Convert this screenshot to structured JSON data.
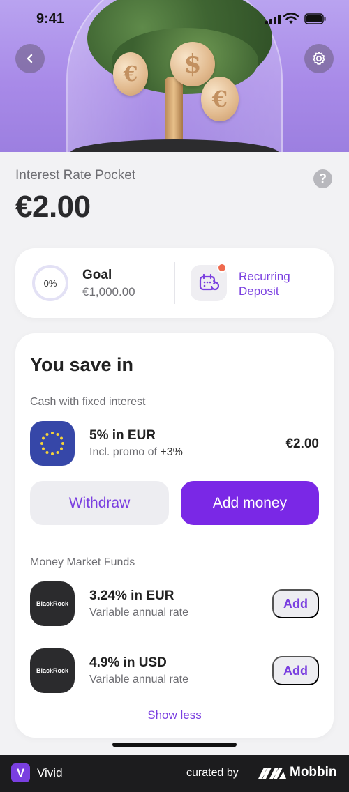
{
  "status_bar": {
    "time": "9:41"
  },
  "header": {
    "title": "Interest Rate Pocket",
    "balance": "€2.00",
    "help": "?"
  },
  "goal": {
    "progress_label": "0%",
    "progress": 0,
    "label": "Goal",
    "amount": "€1,000.00",
    "recurring_label": "Recurring Deposit"
  },
  "save": {
    "title": "You save in",
    "cash_section": "Cash with fixed interest",
    "eur_item": {
      "title": "5% in EUR",
      "subtitle_prefix": "Incl. promo of ",
      "subtitle_promo": "+3%",
      "value": "€2.00"
    },
    "withdraw_label": "Withdraw",
    "add_money_label": "Add money",
    "mmf_section": "Money Market Funds",
    "funds": [
      {
        "logo": "BlackRock",
        "title": "3.24% in EUR",
        "subtitle": "Variable annual rate",
        "action": "Add"
      },
      {
        "logo": "BlackRock",
        "title": "4.9% in USD",
        "subtitle": "Variable annual rate",
        "action": "Add"
      }
    ],
    "show_less": "Show less"
  },
  "footer": {
    "app_logo": "V",
    "app_name": "Vivid",
    "curated_by": "curated by",
    "brand": "Mobbin"
  },
  "colors": {
    "accent": "#7a3fe0",
    "primary_button": "#7a28e6",
    "hero_bg": "#a88ae8",
    "notification": "#ef6a4e"
  }
}
